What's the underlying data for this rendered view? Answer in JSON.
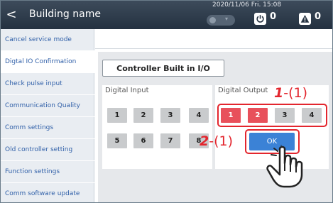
{
  "header": {
    "back_symbol": "<",
    "title": "Building name",
    "datetime": "2020/11/06 Fri. 15:08",
    "power_count": "0",
    "alert_count": "0"
  },
  "sidebar": {
    "items": [
      {
        "label": "Cancel service mode"
      },
      {
        "label": "Digtal IO Confirmation"
      },
      {
        "label": "Check pulse input"
      },
      {
        "label": "Communication Quality"
      },
      {
        "label": "Comm settings"
      },
      {
        "label": "Old controller setting"
      },
      {
        "label": "Function settings"
      },
      {
        "label": "Comm software update"
      }
    ],
    "active_index": 1
  },
  "main": {
    "tab_label": "Controller Built in I/O",
    "digital_input": {
      "title": "Digital Input",
      "buttons": [
        "1",
        "2",
        "3",
        "4",
        "5",
        "6",
        "7",
        "8"
      ]
    },
    "digital_output": {
      "title": "Digital Output",
      "buttons": [
        {
          "label": "1",
          "state": "on"
        },
        {
          "label": "2",
          "state": "on"
        },
        {
          "label": "3",
          "state": "off"
        },
        {
          "label": "4",
          "state": "off"
        }
      ],
      "ok_label": "OK"
    }
  },
  "annotations": {
    "step1_num": "1",
    "step1_sub": "-(1)",
    "step2_num": "2",
    "step2_sub": "-(1)"
  },
  "colors": {
    "header": "#2f3c4c",
    "io_on": "#e8505b",
    "io_off": "#c9cbcd",
    "ok": "#3b82d6",
    "callout": "#e3262e",
    "link_text": "#2f5fa8"
  },
  "icons": {
    "back": "chevron-left-icon",
    "toggle": "toggle-icon",
    "power": "power-icon",
    "alert": "warning-icon",
    "hand": "hand-pointer-icon"
  }
}
